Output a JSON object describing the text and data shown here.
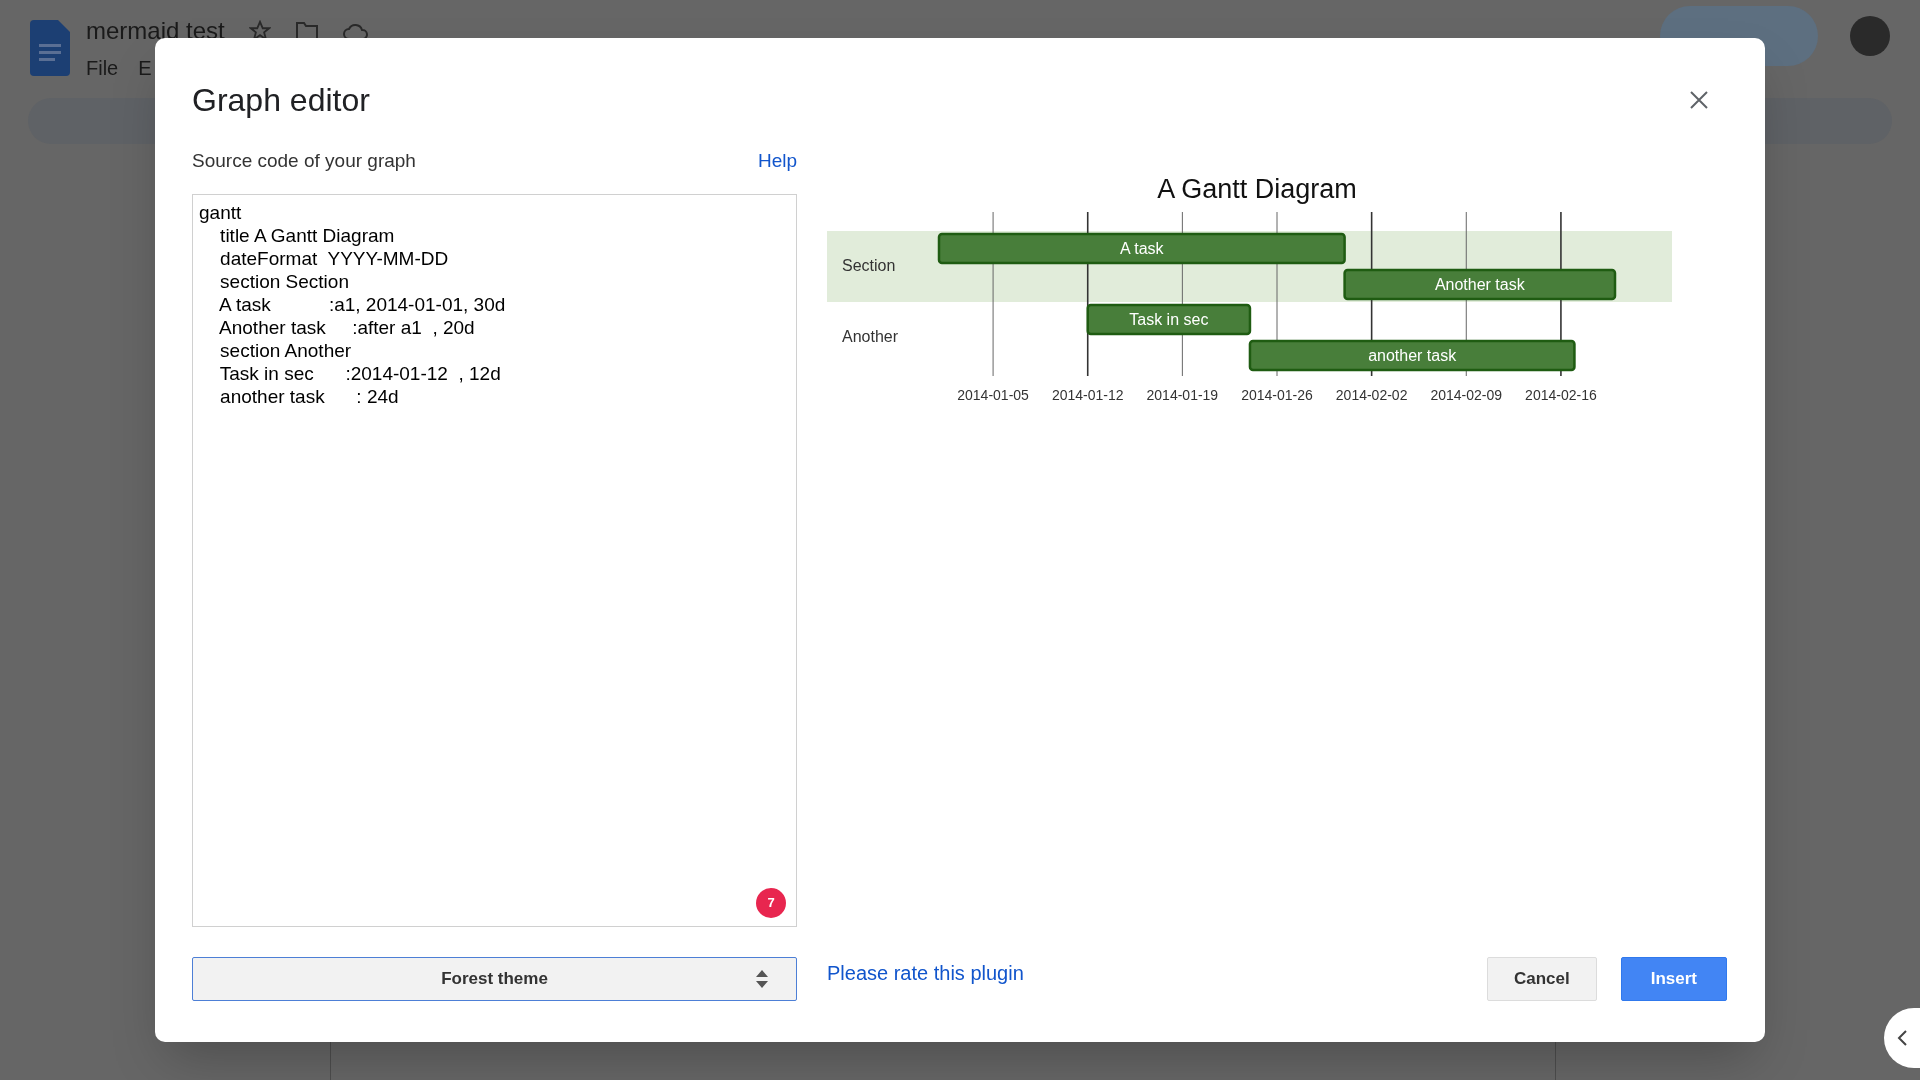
{
  "document": {
    "title": "mermaid test",
    "menu": [
      "File",
      "E"
    ]
  },
  "dialog": {
    "title": "Graph editor",
    "source_label": "Source code of your graph",
    "help_link": "Help",
    "code_lines": [
      "gantt",
      "    title A Gantt Diagram",
      "    dateFormat  YYYY-MM-DD",
      "    section Section",
      "    A task           :a1, 2014-01-01, 30d",
      "    Another task     :after a1  , 20d",
      "    section Another",
      "    Task in sec      :2014-01-12  , 12d",
      "    another task      : 24d"
    ],
    "issue_count": "7",
    "theme_select": {
      "value": "Forest theme"
    },
    "rate_link": "Please rate this plugin",
    "buttons": [
      {
        "label": "Cancel",
        "kind": "secondary"
      },
      {
        "label": "Insert",
        "kind": "primary"
      }
    ],
    "gantt": {
      "title": "A Gantt Diagram",
      "sections": [
        {
          "label": "Section",
          "shaded": true,
          "tasks": [
            {
              "label": "A task"
            },
            {
              "label": "Another task"
            }
          ]
        },
        {
          "label": "Another",
          "shaded": false,
          "tasks": [
            {
              "label": "Task in sec"
            },
            {
              "label": "another task"
            }
          ]
        }
      ],
      "axis_labels": [
        "2014-01-05",
        "2014-01-12",
        "2014-01-19",
        "2014-01-26",
        "2014-02-02",
        "2014-02-09",
        "2014-02-16"
      ]
    }
  }
}
